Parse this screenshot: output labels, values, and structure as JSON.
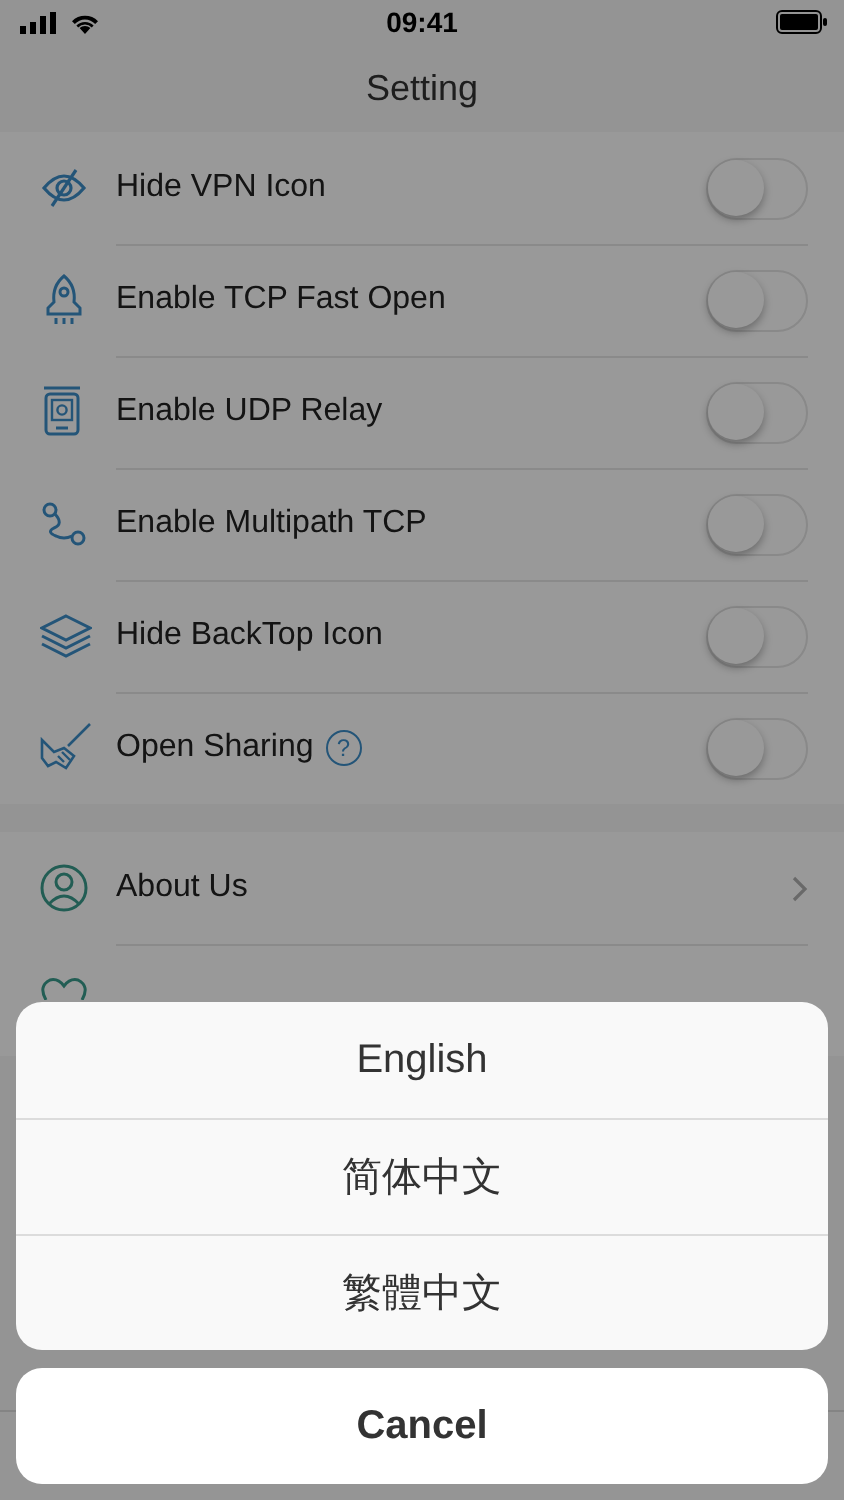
{
  "status_bar": {
    "time": "09:41"
  },
  "title": "Setting",
  "toggles": [
    {
      "label": "Hide VPN Icon",
      "on": false
    },
    {
      "label": "Enable TCP Fast Open",
      "on": false
    },
    {
      "label": "Enable UDP Relay",
      "on": false
    },
    {
      "label": "Enable Multipath TCP",
      "on": false
    },
    {
      "label": "Hide BackTop Icon",
      "on": false
    },
    {
      "label": "Open Sharing",
      "on": false,
      "help": "?"
    }
  ],
  "links": [
    {
      "label": "About Us"
    }
  ],
  "action_sheet": {
    "options": [
      "English",
      "简体中文",
      "繁體中文"
    ],
    "cancel": "Cancel"
  }
}
